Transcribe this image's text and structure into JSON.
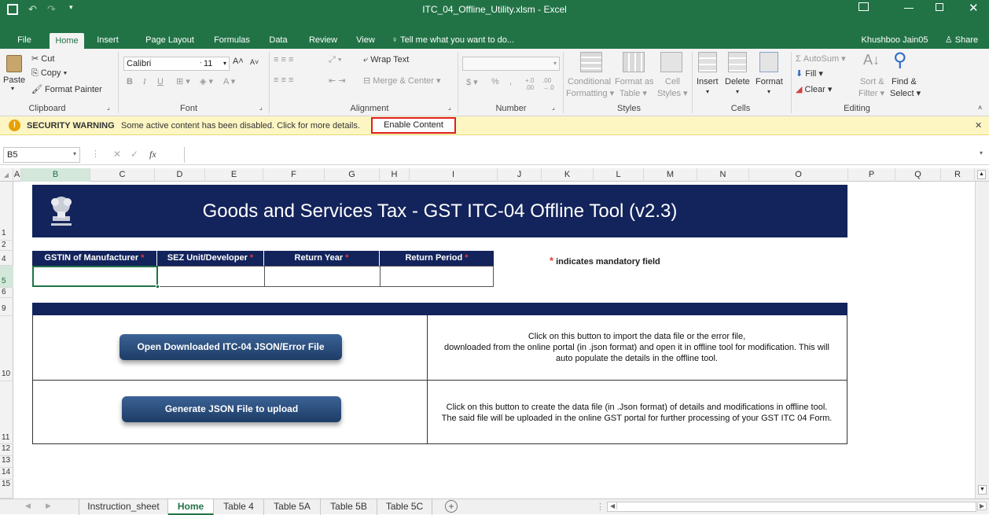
{
  "window": {
    "title": "ITC_04_Offline_Utility.xlsm - Excel",
    "user": "Khushboo Jain05",
    "share": "Share"
  },
  "ribbon_tabs": [
    "File",
    "Home",
    "Insert",
    "Page Layout",
    "Formulas",
    "Data",
    "Review",
    "View"
  ],
  "tell_me": "Tell me what you want to do...",
  "clipboard": {
    "paste": "Paste",
    "cut": "Cut",
    "copy": "Copy",
    "format_painter": "Format Painter",
    "label": "Clipboard"
  },
  "font": {
    "name": "Calibri",
    "size": "11",
    "label": "Font"
  },
  "alignment": {
    "wrap": "Wrap Text",
    "merge": "Merge & Center",
    "label": "Alignment"
  },
  "number": {
    "label": "Number",
    "currency": "$",
    "percent": "%",
    "comma": ",",
    "inc_dec": "←.0 .00",
    "dec_dec": ".00 →.0"
  },
  "styles": {
    "cond1": "Conditional",
    "cond2": "Formatting",
    "fmt1": "Format as",
    "fmt2": "Table",
    "cell1": "Cell",
    "cell2": "Styles",
    "label": "Styles"
  },
  "cells": {
    "insert": "Insert",
    "delete": "Delete",
    "format": "Format",
    "label": "Cells"
  },
  "editing": {
    "autosum": "AutoSum",
    "fill": "Fill",
    "clear": "Clear",
    "sort1": "Sort &",
    "sort2": "Filter",
    "find1": "Find &",
    "find2": "Select",
    "label": "Editing"
  },
  "security": {
    "label": "SECURITY WARNING",
    "message": "Some active content has been disabled. Click for more details.",
    "button": "Enable Content"
  },
  "formula_bar": {
    "name_box": "B5",
    "fx": "fx",
    "value": ""
  },
  "columns": [
    "A",
    "B",
    "C",
    "D",
    "E",
    "F",
    "G",
    "H",
    "I",
    "J",
    "K",
    "L",
    "M",
    "N",
    "O",
    "P",
    "Q",
    "R"
  ],
  "rows": [
    "1",
    "2",
    "4",
    "5",
    "6",
    "9",
    "10",
    "11",
    "12",
    "13",
    "14",
    "15"
  ],
  "sheet": {
    "banner_title": "Goods and Services Tax - GST ITC-04 Offline Tool (v2.3)",
    "headers": [
      {
        "label": "GSTIN of Manufacturer",
        "star": "*"
      },
      {
        "label": "SEZ Unit/Developer",
        "star": "*"
      },
      {
        "label": "Return Year",
        "star": "*"
      },
      {
        "label": "Return Period",
        "star": "*"
      }
    ],
    "mandatory_star": "*",
    "mandatory_text": "indicates mandatory field",
    "open_button": "Open Downloaded ITC-04 JSON/Error File",
    "open_desc_1": "Click on this button to import the data file or the error file,",
    "open_desc_2": "downloaded from the online portal (in .json format) and open it in offline tool for modification. This will",
    "open_desc_3": "auto populate the details in  the offline tool.",
    "gen_button": "Generate JSON File to upload",
    "gen_desc_1": "Click on this button to create the data file (in .Json format) of details and modifications in offline tool.",
    "gen_desc_2": "The said file will be uploaded in the online GST portal for further processing of your GST ITC 04 Form."
  },
  "sheet_tabs": [
    "Instruction_sheet",
    "Home",
    "Table 4",
    "Table 5A",
    "Table 5B",
    "Table 5C"
  ],
  "active_sheet": "Home"
}
